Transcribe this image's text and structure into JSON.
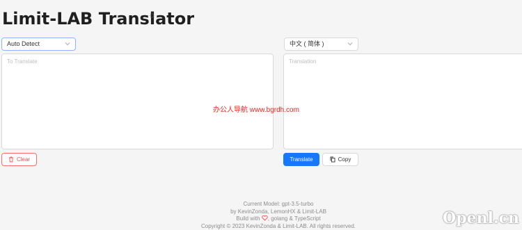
{
  "app": {
    "title": "Limit-LAB Translator",
    "title_icon": "☼"
  },
  "source": {
    "language": "Auto Detect",
    "placeholder": "To Translate"
  },
  "target": {
    "language": "中文 ( 简体 )",
    "placeholder": "Translation"
  },
  "watermark": "办公人导航  www.bgrdh.com",
  "buttons": {
    "clear": "Clear",
    "translate": "Translate",
    "copy": "Copy"
  },
  "footer": {
    "model": "Current Model: gpt-3.5-turbo",
    "authors": "by KevinZonda, LemonHX & Limit-LAB",
    "build_prefix": "Build with",
    "build_suffix": ", golang & TypeScript",
    "copyright": "Copyright © 2023 KevinZonda & Limit-LAB. All rights reserved."
  },
  "corner_mark": "Openl.cn",
  "colors": {
    "primary": "#1677ff",
    "danger": "#ff4d4f",
    "watermark": "#e0281f"
  },
  "icons": [
    "sun-icon",
    "chevron-down-icon",
    "trash-icon",
    "copy-icon",
    "heart-icon"
  ]
}
